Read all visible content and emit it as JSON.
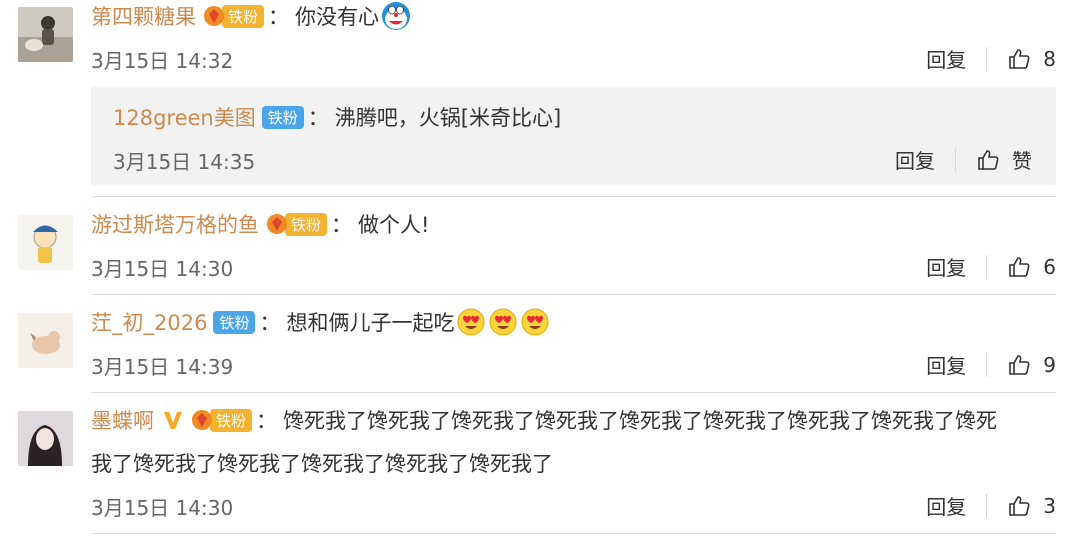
{
  "comments": [
    {
      "username": "第四颗糖果",
      "badge": "铁粉",
      "text": "你没有心",
      "emoji": "doraemon-emoji",
      "date": "3月15日 14:32",
      "reply_label": "回复",
      "likes": "8",
      "reply": {
        "username": "128green美图",
        "badge": "铁粉",
        "text": "沸腾吧，火锅[米奇比心]",
        "date": "3月15日 14:35",
        "reply_label": "回复",
        "likes": "赞"
      }
    },
    {
      "username": "游过斯塔万格的鱼",
      "badge": "铁粉",
      "text": "做个人!",
      "date": "3月15日 14:30",
      "reply_label": "回复",
      "likes": "6"
    },
    {
      "username": "茳_初_2026",
      "badge": "铁粉",
      "text": "想和俩儿子一起吃",
      "emoji": "heart-eyes-emoji",
      "date": "3月15日 14:39",
      "reply_label": "回复",
      "likes": "9"
    },
    {
      "username": "墨蝶啊",
      "badge": "铁粉",
      "text_line1": "馋死我了馋死我了馋死我了馋死我了馋死我了馋死我了馋死我了馋死我了馋死",
      "text_line2": "我了馋死我了馋死我了馋死我了馋死我了馋死我了",
      "date": "3月15日 14:30",
      "reply_label": "回复",
      "likes": "3"
    }
  ],
  "colors": {
    "username": "#cc8a4e",
    "badge_gold": "#f3b230",
    "badge_blue": "#4aa6e8",
    "vip": "#f5a623"
  }
}
